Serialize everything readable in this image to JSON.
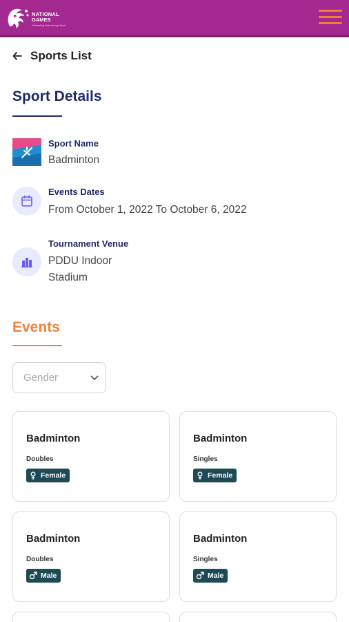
{
  "header": {
    "logo_line1": "NATIONAL",
    "logo_line2": "GAMES",
    "logo_sub": "Celebrating Unity through Sport",
    "brand_color": "#a3288f",
    "accent_color": "#f07d3a",
    "menu_icon": "hamburger-menu-icon"
  },
  "nav": {
    "back_label": "Sports List",
    "back_icon": "arrow-left-icon"
  },
  "sport_details": {
    "title": "Sport Details",
    "items": [
      {
        "label": "Sport Name",
        "value": "Badminton",
        "icon": "badminton-thumbnail"
      },
      {
        "label": "Events Dates",
        "value": "From October 1, 2022 To October 6, 2022",
        "icon": "calendar-icon"
      },
      {
        "label": "Tournament Venue",
        "value": "PDDU Indoor Stadium",
        "icon": "building-icon"
      }
    ]
  },
  "events": {
    "title": "Events",
    "filter": {
      "placeholder": "Gender",
      "icon": "chevron-down-icon"
    },
    "cards": [
      {
        "title": "Badminton",
        "type": "Doubles",
        "gender": "Female",
        "gender_icon": "female-icon"
      },
      {
        "title": "Badminton",
        "type": "Singles",
        "gender": "Female",
        "gender_icon": "female-icon"
      },
      {
        "title": "Badminton",
        "type": "Doubles",
        "gender": "Male",
        "gender_icon": "male-icon"
      },
      {
        "title": "Badminton",
        "type": "Singles",
        "gender": "Male",
        "gender_icon": "male-icon"
      }
    ]
  }
}
